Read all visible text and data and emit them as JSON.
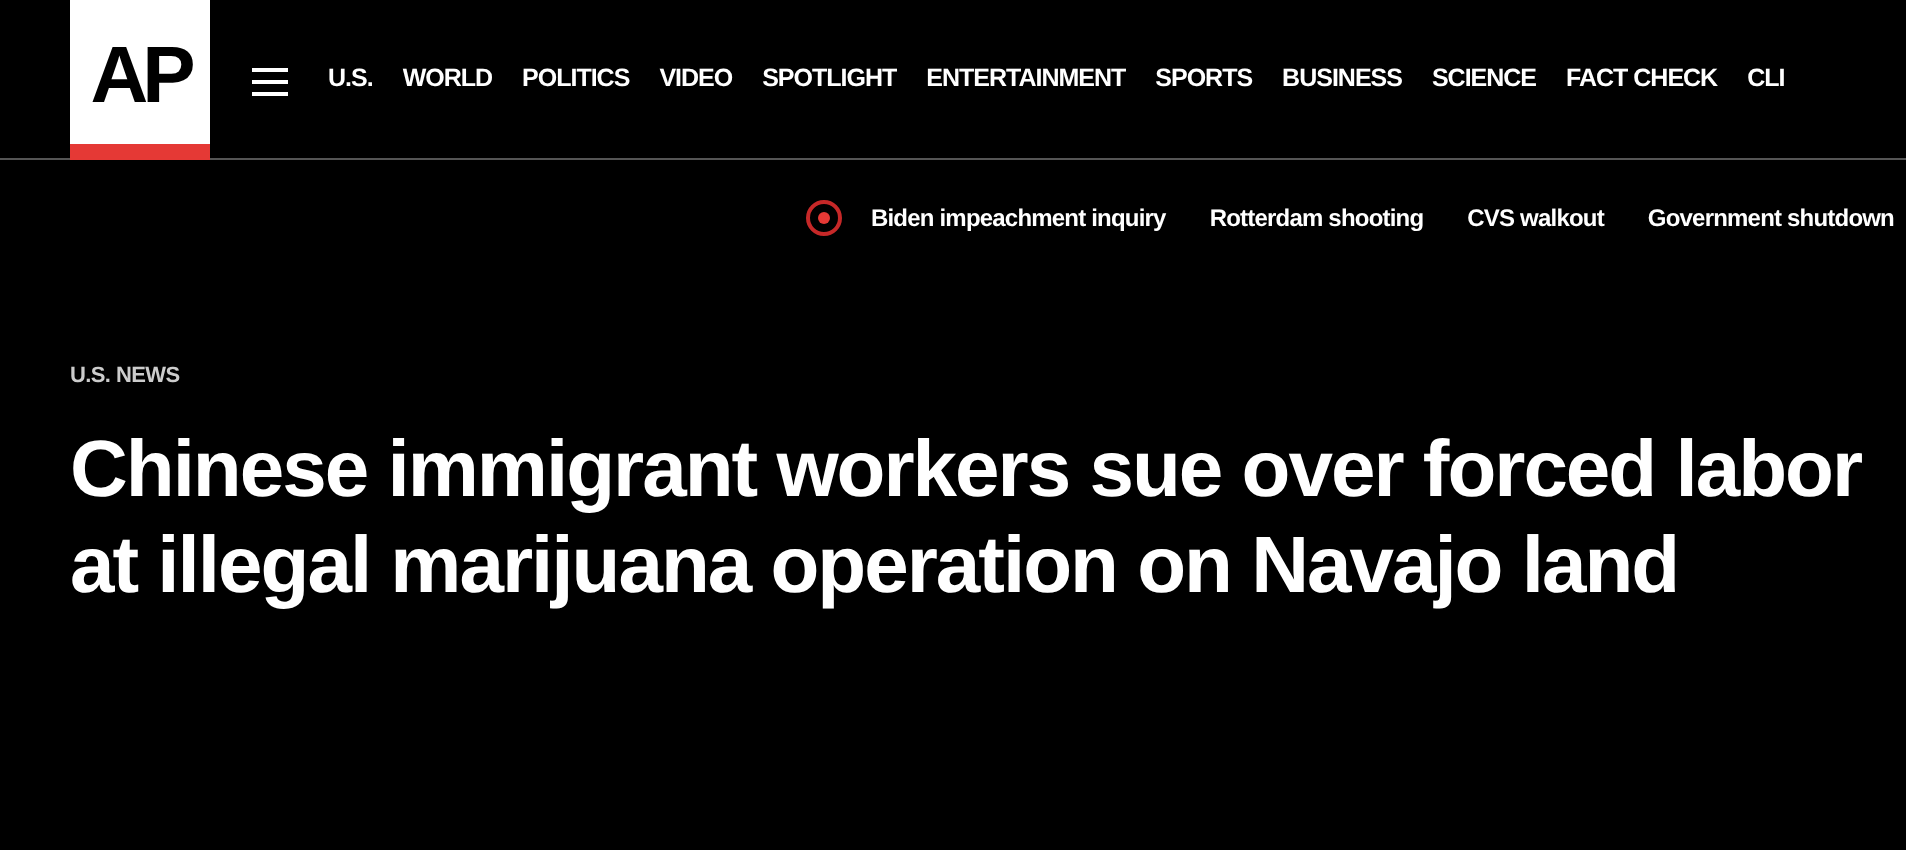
{
  "logo": "AP",
  "nav": [
    "U.S.",
    "WORLD",
    "POLITICS",
    "VIDEO",
    "SPOTLIGHT",
    "ENTERTAINMENT",
    "SPORTS",
    "BUSINESS",
    "SCIENCE",
    "FACT CHECK",
    "CLI"
  ],
  "trending": [
    "Biden impeachment inquiry",
    "Rotterdam shooting",
    "CVS walkout",
    "Government shutdown"
  ],
  "article": {
    "section": "U.S. NEWS",
    "headline": "Chinese immigrant workers sue over forced labor at illegal marijuana operation on Navajo land"
  }
}
